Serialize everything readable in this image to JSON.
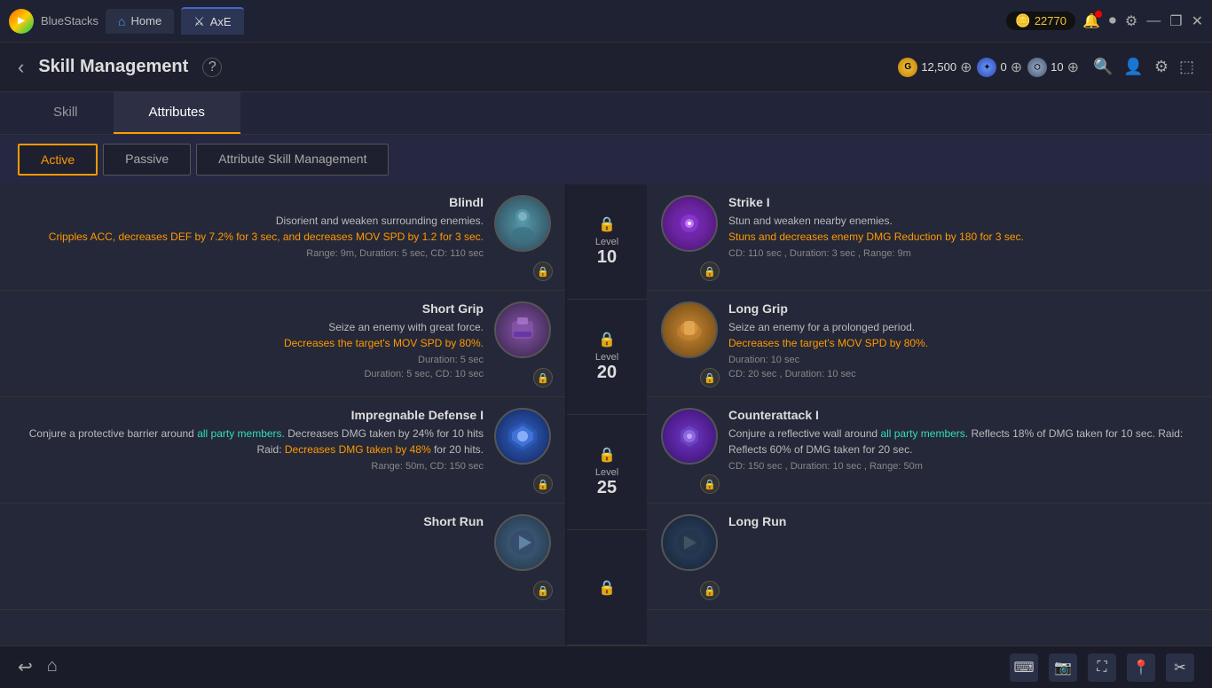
{
  "app": {
    "name": "BlueStacks",
    "coin_value": "22770"
  },
  "tabs": {
    "home": "Home",
    "axe": "AxE"
  },
  "header": {
    "title": "Skill Management",
    "back": "‹",
    "help": "?",
    "currency": [
      {
        "icon": "G",
        "value": "12,500",
        "type": "gold"
      },
      {
        "icon": "✦",
        "value": "0",
        "type": "crystal"
      },
      {
        "icon": "⬡",
        "value": "10",
        "type": "shield"
      }
    ]
  },
  "main_tabs": [
    {
      "label": "Skill",
      "active": false
    },
    {
      "label": "Attributes",
      "active": true
    }
  ],
  "sub_tabs": [
    {
      "label": "Active",
      "active": true
    },
    {
      "label": "Passive",
      "active": false
    },
    {
      "label": "Attribute Skill Management",
      "active": false
    }
  ],
  "skills_left": [
    {
      "name": "BlindI",
      "desc_plain": "Disorient and weaken surrounding enemies.",
      "desc_highlight": "Cripples ACC, decreases DEF by 7.2% for 3 sec, and decreases MOV SPD by 1.2 for 3 sec.",
      "highlight_color": "orange",
      "meta": "Range: 9m, Duration: 5 sec, CD: 110 sec",
      "icon_class": "blind-i",
      "icon_symbol": "👤"
    },
    {
      "name": "Short Grip",
      "desc_plain": "Seize an enemy with great force.",
      "desc_highlight": "Decreases the target's MOV SPD by 80%.",
      "highlight_color": "orange",
      "meta_line1": "Duration: 5 sec",
      "meta": "Duration: 5 sec, CD: 10 sec",
      "icon_class": "short-grip",
      "icon_symbol": "✊"
    },
    {
      "name": "Impregnable Defense I",
      "desc_plain": "Conjure a protective barrier around",
      "desc_highlight1": "all party members.",
      "desc_highlight1_color": "teal",
      "desc_plain2": "Decreases DMG taken by 24% for 10 hits Raid:",
      "desc_highlight2": "Decreases DMG taken by 48%",
      "desc_plain3": "for 20 hits.",
      "highlight_color": "orange",
      "meta": "Range: 50m, CD: 150 sec",
      "icon_class": "impregnable",
      "icon_symbol": "❄"
    },
    {
      "name": "Short Run",
      "desc_plain": "",
      "meta": "",
      "icon_class": "short-run",
      "icon_symbol": "▶"
    }
  ],
  "levels": [
    {
      "lock": true,
      "level_label": "Level",
      "level_num": "10"
    },
    {
      "lock": true,
      "level_label": "Level",
      "level_num": "20"
    },
    {
      "lock": true,
      "level_label": "Level",
      "level_num": "25"
    },
    {
      "lock": true,
      "level_label": "Level",
      "level_num": ""
    }
  ],
  "skills_right": [
    {
      "name": "Strike I",
      "desc_plain": "Stun and weaken nearby enemies.",
      "desc_highlight": "Stuns and decreases enemy DMG Reduction by 180 for 3 sec.",
      "highlight_color": "orange",
      "meta": "CD: 110 sec , Duration: 3 sec , Range: 9m",
      "icon_class": "strike-i",
      "icon_symbol": "⚡"
    },
    {
      "name": "Long Grip",
      "desc_plain": "Seize an enemy for a prolonged period.",
      "desc_highlight": "Decreases the target's MOV SPD by 80%.",
      "highlight_color": "orange",
      "meta_line1": "Duration: 10 sec",
      "meta": "CD: 20 sec , Duration: 10 sec",
      "icon_class": "long-grip",
      "icon_symbol": "✊"
    },
    {
      "name": "Counterattack I",
      "desc_plain": "Conjure a reflective wall around",
      "desc_highlight1": "all party members.",
      "desc_highlight1_color": "teal",
      "desc_plain2": "Reflects 18% of DMG taken",
      "desc_plain3": "for 10 sec. Raid: Reflects 60% of DMG taken for 20 sec.",
      "highlight_color": "orange",
      "meta": "CD: 150 sec , Duration: 10 sec , Range: 50m",
      "icon_class": "counterattack",
      "icon_symbol": "🛡"
    },
    {
      "name": "Long Run",
      "desc_plain": "",
      "meta": "",
      "icon_class": "long-run",
      "icon_symbol": "▶"
    }
  ],
  "bottom_bar": {
    "icons": [
      "↩",
      "⌂"
    ]
  }
}
